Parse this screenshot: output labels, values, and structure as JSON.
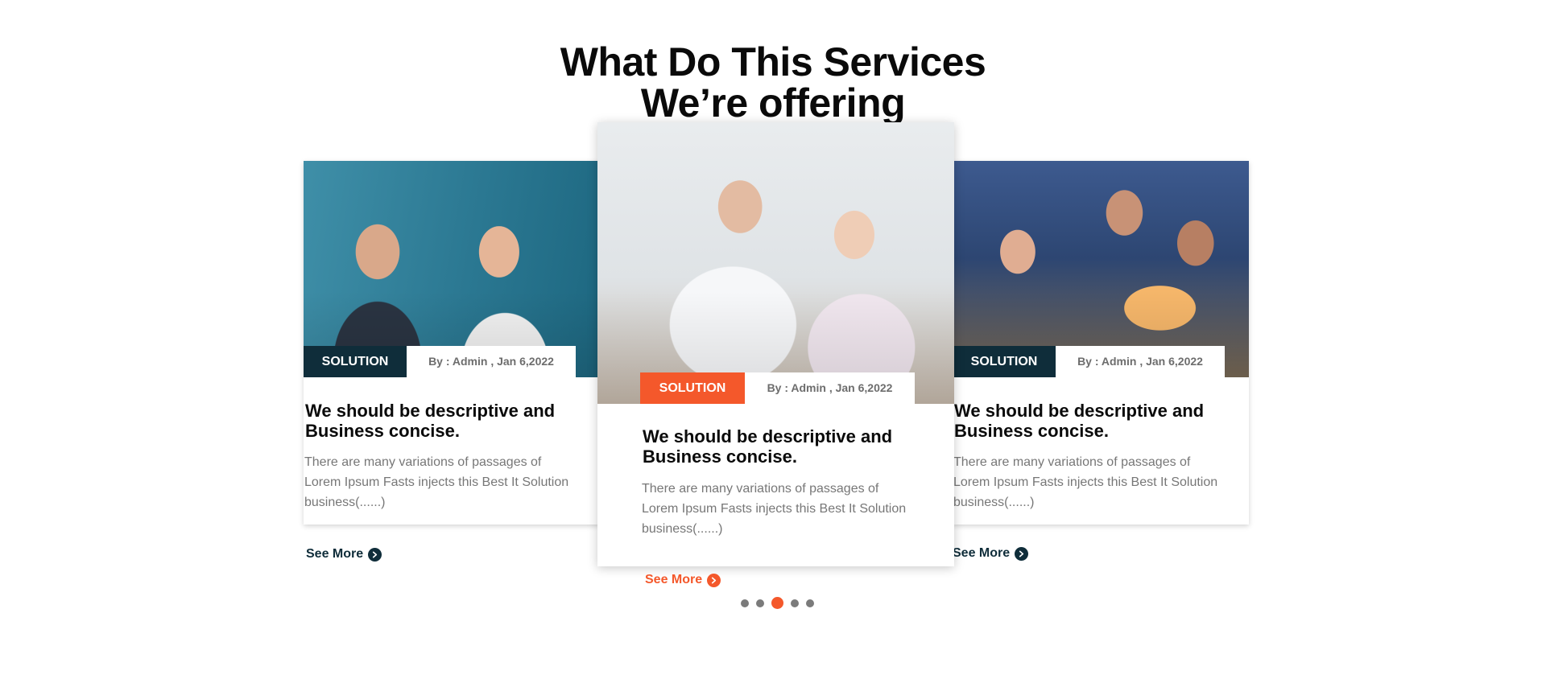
{
  "section": {
    "heading_line1": "What Do This Services",
    "heading_line2": "We’re offering"
  },
  "cards": [
    {
      "tag": "SOLUTION",
      "byline": "By : Admin , Jan 6,2022",
      "title": "We should be descriptive and Business concise.",
      "description": "There are many variations of passages of Lorem Ipsum Fasts injects this Best It Solution business(......)",
      "see_more": "See More",
      "tag_color": "#0f2d3a"
    },
    {
      "tag": "SOLUTION",
      "byline": "By : Admin , Jan 6,2022",
      "title": "We should be descriptive and Business concise.",
      "description": "There are many variations of passages of Lorem Ipsum Fasts injects this Best It Solution business(......)",
      "see_more": "See More",
      "tag_color": "#f4582b"
    },
    {
      "tag": "SOLUTION",
      "byline": "By : Admin , Jan 6,2022",
      "title": "We should be descriptive and Business concise.",
      "description": "There are many variations of passages of Lorem Ipsum Fasts injects this Best It Solution business(......)",
      "see_more": "See More",
      "tag_color": "#0f2d3a"
    }
  ],
  "carousel": {
    "total_pages": 5,
    "active_page": 3,
    "active_color": "#f4582b",
    "inactive_color": "#7b7b7b"
  },
  "colors": {
    "accent": "#f4582b",
    "dark": "#0f2d3a"
  }
}
